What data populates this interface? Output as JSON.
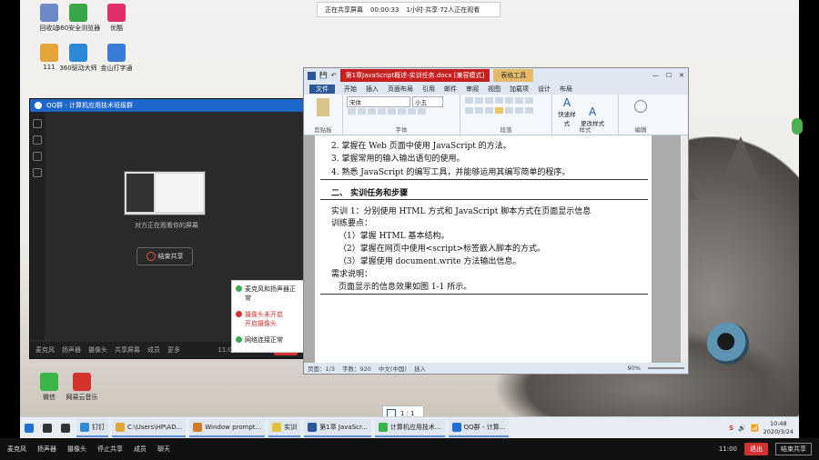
{
  "top_banner": {
    "title": "正在共享屏幕",
    "timer": "00:00:33",
    "attendees": "1小时·共享·72人正在观看"
  },
  "desktop_icons": [
    {
      "label": "回收站",
      "color": "#6c8ac7"
    },
    {
      "label": "360安全浏览器",
      "color": "#3aa64a"
    },
    {
      "label": "优酷",
      "color": "#e0306b"
    },
    {
      "label": "111",
      "color": "#e3a53a"
    },
    {
      "label": "360驱动大师",
      "color": "#2e8ad8"
    },
    {
      "label": "金山打字通",
      "color": "#3a7bd5"
    },
    {
      "label": "微信",
      "color": "#3ab54a"
    },
    {
      "label": "网易云音乐",
      "color": "#d3322f"
    }
  ],
  "qq_window": {
    "title": "QQ群 - 计算机应用技术班级群",
    "caption": "对方正在观看你的屏幕",
    "stop_button": "结束共享",
    "bottom": [
      "麦克风",
      "扬声器",
      "摄像头",
      "共享屏幕",
      "成员",
      "更多"
    ],
    "time": "11:00",
    "end": "退出"
  },
  "notifications": [
    {
      "text": "麦克风和扬声器正常",
      "color": "#3aaa55"
    },
    {
      "text": "摄像头未开启",
      "sub": "开启摄像头",
      "color": "#d3322f"
    },
    {
      "text": "网络连接正常",
      "color": "#3aaa55"
    }
  ],
  "word": {
    "title": "第1章JavaScript概述-实训任务.docx [兼容模式]",
    "tools_tab": "表格工具",
    "tabs": [
      "文件",
      "开始",
      "插入",
      "页面布局",
      "引用",
      "邮件",
      "审阅",
      "视图",
      "加载项",
      "设计",
      "布局"
    ],
    "groups": [
      "剪贴板",
      "字体",
      "段落",
      "样式",
      "编辑"
    ],
    "font_name": "宋体",
    "font_size": "小五",
    "style_labels": [
      "快速样式",
      "更改样式"
    ],
    "lines": [
      "2.  掌握在 Web 页面中使用 JavaScript 的方法。",
      "3.  掌握常用的输入输出语句的使用。",
      "4.  熟悉 JavaScript 的编写工具，并能够运用其编写简单的程序。",
      "二、 实训任务和步骤",
      "实训 1：分别使用 HTML 方式和 JavaScript 脚本方式在页面显示信息",
      "训练要点：",
      "（1）掌握 HTML 基本结构。",
      "（2）掌握在网页中使用<script>标签嵌入脚本的方式。",
      "（3）掌握使用 document.write 方法输出信息。",
      "需求说明：",
      "页面显示的信息效果如图 1-1 所示。"
    ],
    "status": {
      "page": "页面：1/3",
      "words": "字数：920",
      "lang": "中文(中国)",
      "mode": "插入",
      "zoom": "90%"
    }
  },
  "page_tip": "1 : 1",
  "taskbar": {
    "items": [
      {
        "label": "开始",
        "color": "#1f6fd6"
      },
      {
        "label": "搜索",
        "color": "#333"
      },
      {
        "label": "任务视图",
        "color": "#333"
      },
      {
        "label": "钉钉",
        "color": "#2e8ad8"
      },
      {
        "label": "C:\\Users\\HP\\AD...",
        "color": "#e3a53a"
      },
      {
        "label": "Window prompt...",
        "color": "#d07a2a"
      },
      {
        "label": "实训",
        "color": "#e3c13a"
      },
      {
        "label": "第1章 JavaScr...",
        "color": "#2b5797"
      },
      {
        "label": "计算机应用技术...",
        "color": "#3ab54a"
      },
      {
        "label": "QQ群 - 计算...",
        "color": "#1f6fd6"
      }
    ],
    "time": "10:48",
    "date": "2020/3/24"
  },
  "outer_bar": {
    "left": [
      "麦克风",
      "扬声器",
      "摄像头",
      "停止共享",
      "成员",
      "聊天"
    ],
    "time": "11:00",
    "end": "退出",
    "right": "结束共享"
  }
}
